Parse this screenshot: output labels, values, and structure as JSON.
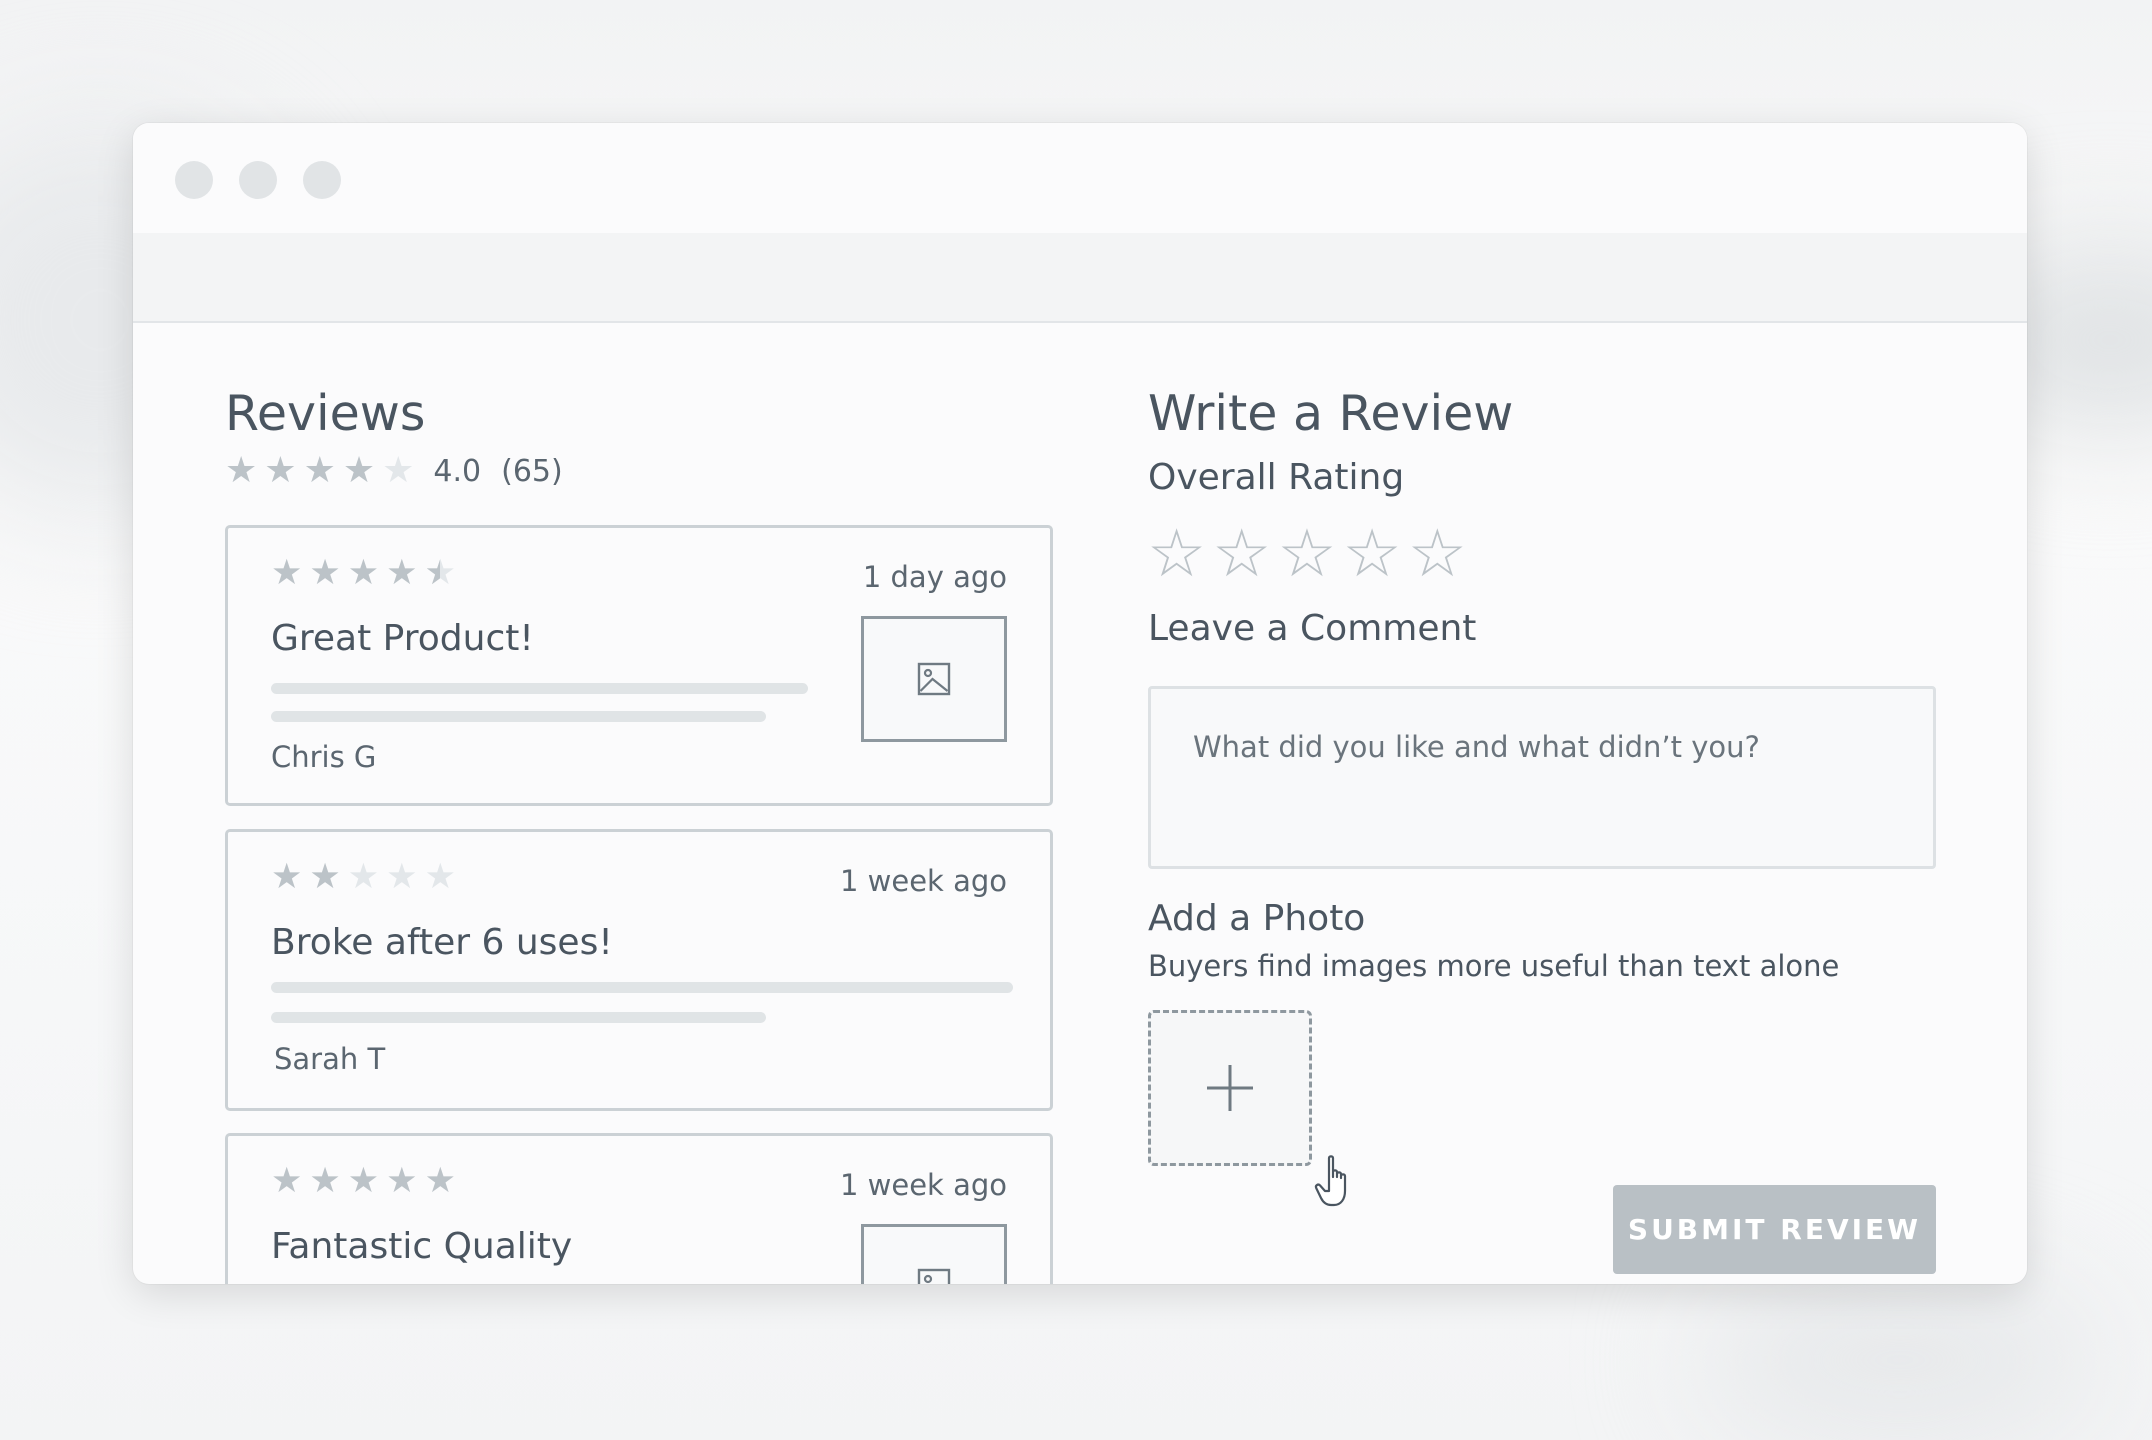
{
  "reviews": {
    "title": "Reviews",
    "summary": {
      "rating": "4.0",
      "count": "(65)"
    },
    "items": [
      {
        "time": "1 day ago",
        "headline": "Great Product!",
        "author": "Chris G"
      },
      {
        "time": "1 week ago",
        "headline": "Broke after 6 uses!",
        "author": "Sarah T"
      },
      {
        "time": "1 week ago",
        "headline": "Fantastic Quality",
        "author": ""
      }
    ]
  },
  "form": {
    "title": "Write a Review",
    "rating_label": "Overall Rating",
    "comment_label": "Leave a Comment",
    "comment_placeholder": "What did you like and what didn’t you?",
    "photo_label": "Add a Photo",
    "photo_hint": "Buyers find images more useful than text alone",
    "submit_label": "SUBMIT REVIEW"
  },
  "colors": {
    "accent_disabled": "#b9c0c5",
    "star_filled": "#bcc3c8",
    "star_empty": "#e3e7ea"
  }
}
